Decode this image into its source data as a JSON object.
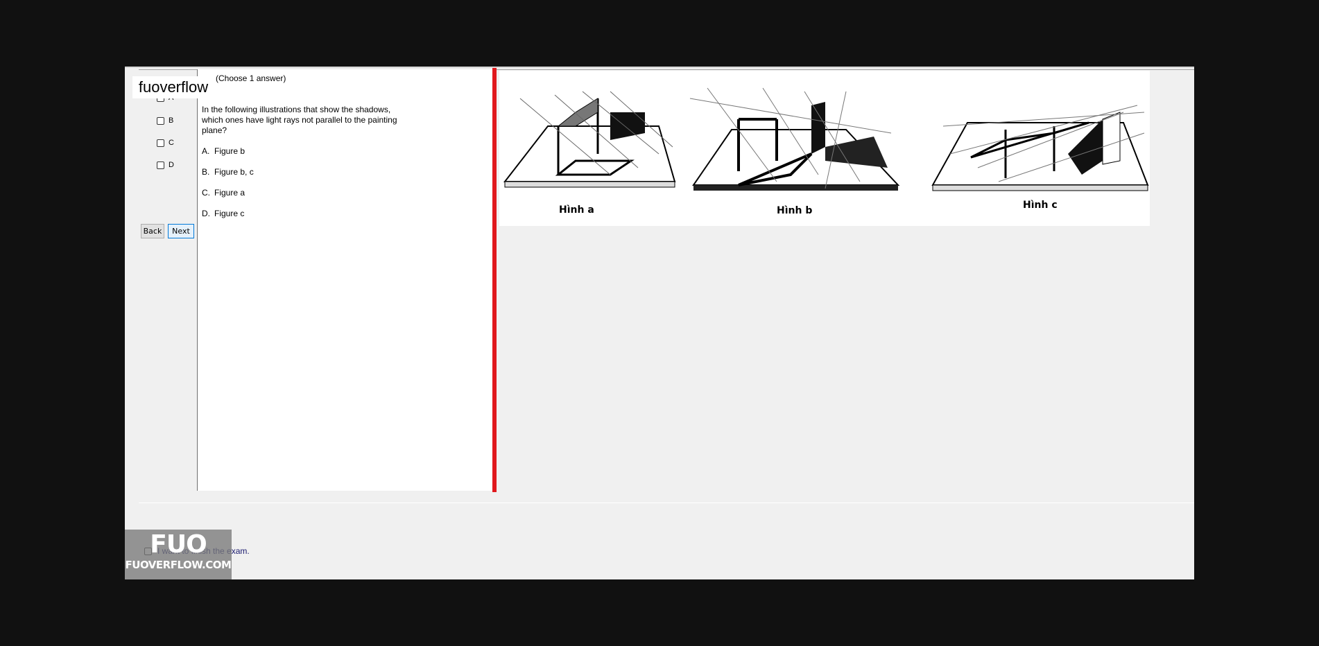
{
  "watermark": {
    "text": "fuoverflow"
  },
  "answer_options": [
    {
      "label": "A"
    },
    {
      "label": "B"
    },
    {
      "label": "C"
    },
    {
      "label": "D"
    }
  ],
  "nav": {
    "back_label": "Back",
    "next_label": "Next"
  },
  "question": {
    "header": "(Choose 1 answer)",
    "text": "In the following illustrations that show the shadows, which ones have light rays not parallel to the painting plane?",
    "options": [
      {
        "letter": "A.",
        "text": "Figure b"
      },
      {
        "letter": "B.",
        "text": "Figure b, c"
      },
      {
        "letter": "C.",
        "text": "Figure a"
      },
      {
        "letter": "D.",
        "text": "Figure c"
      }
    ]
  },
  "figures": [
    {
      "label": "Hình a"
    },
    {
      "label": "Hình b"
    },
    {
      "label": "Hình c"
    }
  ],
  "finish": {
    "label": "I want to finish the exam."
  },
  "logo": {
    "big": "FUO",
    "small": "FUOVERFLOW.COM"
  },
  "colors": {
    "divider": "#e0181d",
    "next_button_border": "#0078d7"
  }
}
